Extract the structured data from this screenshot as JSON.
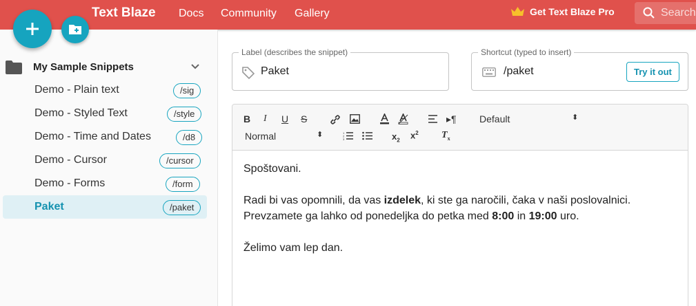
{
  "header": {
    "brand": "Text Blaze",
    "nav": [
      "Docs",
      "Community",
      "Gallery"
    ],
    "pro_label": "Get Text Blaze Pro",
    "search_placeholder": "Search"
  },
  "sidebar": {
    "folder": "My Sample Snippets",
    "items": [
      {
        "label": "Demo - Plain text",
        "shortcut": "/sig"
      },
      {
        "label": "Demo - Styled Text",
        "shortcut": "/style"
      },
      {
        "label": "Demo - Time and Dates",
        "shortcut": "/d8"
      },
      {
        "label": "Demo - Cursor",
        "shortcut": "/cursor"
      },
      {
        "label": "Demo - Forms",
        "shortcut": "/form"
      },
      {
        "label": "Paket",
        "shortcut": "/paket"
      }
    ]
  },
  "label_field": {
    "legend": "Label (describes the snippet)",
    "value": "Paket"
  },
  "shortcut_field": {
    "legend": "Shortcut (typed to insert)",
    "value": "/paket",
    "try_label": "Try it out"
  },
  "toolbar": {
    "font_select": "Default",
    "heading_select": "Normal"
  },
  "body": {
    "line1": "Spoštovani.",
    "line2_a": "Radi bi vas opomnili, da vas ",
    "line2_b": "izdelek",
    "line2_c": ", ki ste ga naročili, čaka v naši poslovalnici.",
    "line3_a": "Prevzamete ga lahko od ponedeljka do petka med ",
    "line3_b": "8:00",
    "line3_c": " in ",
    "line3_d": "19:00",
    "line3_e": " uro.",
    "line4": "Želimo vam lep dan."
  }
}
